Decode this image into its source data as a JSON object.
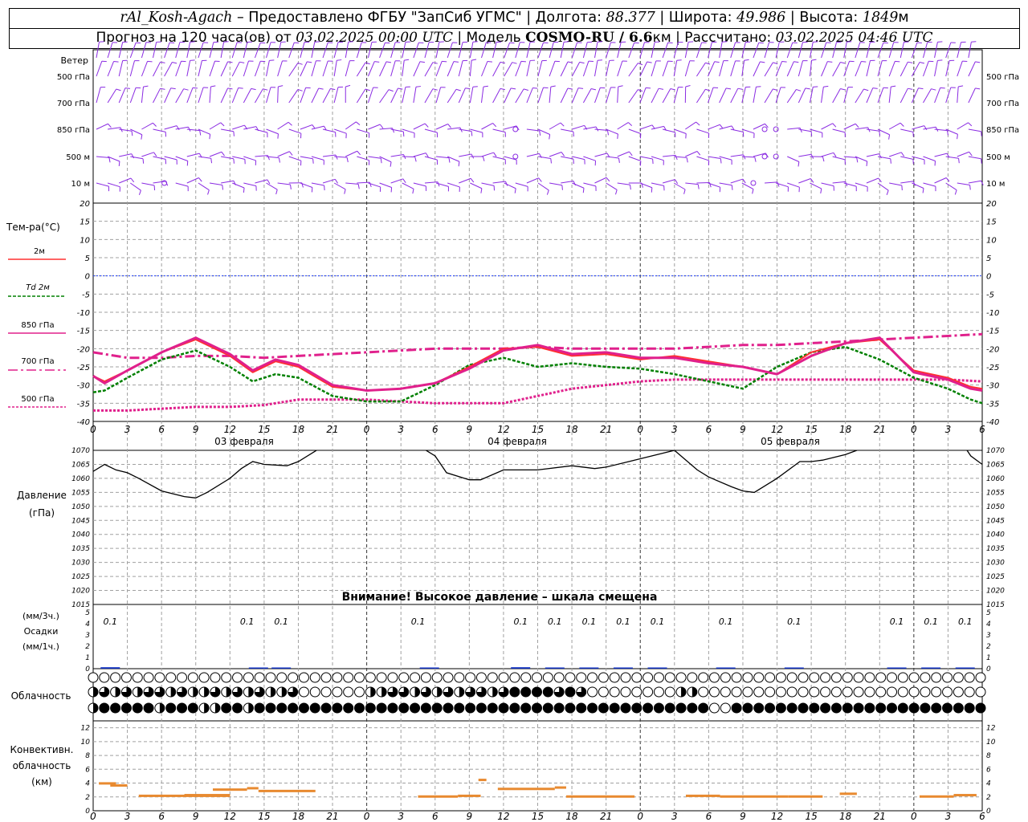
{
  "header": {
    "station": "rAl_Kosh-Agach",
    "provider": " – Предоставлено ФГБУ \"ЗапСиб УГМС\" | Долгота: ",
    "lon": "88.377",
    "lat_label": " | Широта: ",
    "lat": "49.986",
    "alt_label": " | Высота: ",
    "alt": "1849",
    "alt_unit": "м",
    "forecast_label": "Прогноз на 120 часа(ов) от ",
    "forecast_start": "03.02.2025 00:00 UTC",
    "model_label": " | Модель ",
    "model": "COSMO-RU / 6.6",
    "model_unit": "км",
    "calc_label": " | Рассчитано: ",
    "calc_time": "03.02.2025 04:46 UTC"
  },
  "labels": {
    "wind": "Ветер",
    "wind_levels": [
      "500 гПа",
      "700 гПа",
      "850 гПа",
      "500 м",
      "10 м"
    ],
    "temp_title": "Тем-ра(°С)",
    "legend": [
      "2м",
      "Td 2м",
      "850 гПа",
      "700 гПа",
      "500 гПа"
    ],
    "pressure_title": "Давление",
    "pressure_unit": "(гПа)",
    "pressure_warning": "Внимание! Высокое давление – шкала смещена",
    "precip_3h": "(мм/3ч.)",
    "precip_title": "Осадки",
    "precip_1h": "(мм/1ч.)",
    "cloud_title": "Облачность",
    "conv_title": [
      "Конвективн.",
      "облачность",
      "(км)"
    ],
    "dates": [
      "03 февраля",
      "04 февраля",
      "05 февраля"
    ]
  },
  "colors": {
    "t2m": "#ff3030",
    "td2m": "#008000",
    "t850": "#e0208c",
    "t700": "#e0208c",
    "t500": "#e0208c",
    "zero_line": "#2040ff",
    "wind": "#8a2be2",
    "pressure": "#000000",
    "precip": "#1030c0",
    "conv": "#e88a30",
    "grid": "#a0a0a0"
  },
  "chart_data": {
    "x_tick_labels": [
      "0",
      "3",
      "6",
      "9",
      "12",
      "15",
      "18",
      "21",
      "0",
      "3",
      "6",
      "9",
      "12",
      "15",
      "18",
      "21",
      "0",
      "3",
      "6",
      "9",
      "12",
      "15",
      "18",
      "21",
      "0",
      "3",
      "6"
    ],
    "x_hours_range": [
      0,
      78
    ],
    "temperature": {
      "type": "line",
      "ylim": [
        -40,
        20
      ],
      "y_ticks": [
        20,
        15,
        10,
        5,
        0,
        -5,
        -10,
        -15,
        -20,
        -25,
        -30,
        -35,
        -40
      ],
      "grid": true,
      "series": [
        {
          "name": "2м",
          "x": [
            0,
            1,
            3,
            6,
            9,
            12,
            14,
            16,
            18,
            21,
            24,
            27,
            30,
            33,
            36,
            39,
            42,
            45,
            48,
            51,
            54,
            57,
            60,
            63,
            66,
            69,
            72,
            75,
            77,
            78
          ],
          "values": [
            -27.5,
            -29,
            -26,
            -21,
            -17.5,
            -22,
            -26.5,
            -23.5,
            -25,
            -30.5,
            -31.5,
            -31,
            -29.5,
            -25,
            -20,
            -19.5,
            -22,
            -21.5,
            -23,
            -22,
            -23.5,
            -25,
            -27,
            -21,
            -18.5,
            -17.5,
            -26,
            -28,
            -30.5,
            -31
          ]
        },
        {
          "name": "Td 2м",
          "x": [
            0,
            1,
            3,
            6,
            9,
            12,
            14,
            16,
            18,
            21,
            24,
            27,
            30,
            33,
            36,
            39,
            42,
            45,
            48,
            51,
            54,
            57,
            60,
            63,
            66,
            69,
            72,
            75,
            77,
            78
          ],
          "values": [
            -32,
            -31.5,
            -28,
            -23,
            -20.5,
            -25,
            -29,
            -27,
            -28,
            -33,
            -34.5,
            -34.5,
            -30,
            -24.5,
            -22.5,
            -25,
            -24,
            -25,
            -25.5,
            -27,
            -29,
            -31,
            -25,
            -21,
            -19.5,
            -23,
            -28,
            -31,
            -34,
            -35
          ]
        },
        {
          "name": "850 гПа",
          "x": [
            0,
            1,
            3,
            6,
            9,
            12,
            14,
            16,
            18,
            21,
            24,
            27,
            30,
            33,
            36,
            39,
            42,
            45,
            48,
            51,
            54,
            57,
            60,
            63,
            66,
            69,
            72,
            75,
            77,
            78
          ],
          "values": [
            -27.5,
            -29.5,
            -26,
            -21,
            -17,
            -21.5,
            -26,
            -23,
            -24.5,
            -30,
            -31.5,
            -31,
            -29.5,
            -25.5,
            -20.5,
            -19,
            -21.5,
            -21,
            -22.5,
            -22.5,
            -24,
            -25,
            -27,
            -22,
            -18.5,
            -17,
            -26.5,
            -28.5,
            -31,
            -31.5
          ]
        },
        {
          "name": "700 гПа",
          "x": [
            0,
            3,
            6,
            9,
            12,
            15,
            18,
            21,
            24,
            27,
            30,
            33,
            36,
            39,
            42,
            45,
            48,
            51,
            54,
            57,
            60,
            63,
            66,
            69,
            72,
            75,
            78
          ],
          "values": [
            -21,
            -22.5,
            -22.5,
            -22,
            -22,
            -22.5,
            -22,
            -21.5,
            -21,
            -20.5,
            -20,
            -20,
            -20,
            -19.5,
            -20,
            -20,
            -20,
            -20,
            -19.5,
            -19,
            -19,
            -18.5,
            -18,
            -17.5,
            -17,
            -16.5,
            -16
          ]
        },
        {
          "name": "500 гПа",
          "x": [
            0,
            3,
            6,
            9,
            12,
            15,
            18,
            21,
            24,
            27,
            30,
            33,
            36,
            39,
            42,
            45,
            48,
            51,
            54,
            57,
            60,
            63,
            66,
            69,
            72,
            75,
            78
          ],
          "values": [
            -37,
            -37,
            -36.5,
            -36,
            -36,
            -35.5,
            -34,
            -34,
            -34,
            -34.5,
            -35,
            -35,
            -35,
            -33,
            -31,
            -30,
            -29,
            -28.5,
            -28.5,
            -28.5,
            -28.5,
            -28.5,
            -28.5,
            -28.5,
            -28.5,
            -28.5,
            -29
          ]
        }
      ]
    },
    "pressure": {
      "type": "line",
      "ylim": [
        1015,
        1070
      ],
      "y_ticks": [
        1070,
        1065,
        1060,
        1055,
        1050,
        1045,
        1040,
        1035,
        1030,
        1025,
        1020,
        1015
      ],
      "x": [
        0,
        1,
        2,
        3,
        4,
        6,
        8,
        9,
        10,
        12,
        13,
        14,
        15,
        17,
        18,
        20,
        22,
        24,
        25,
        27,
        28,
        30,
        31,
        33,
        34,
        36,
        39,
        42,
        44,
        45,
        47,
        49,
        51,
        53,
        54,
        56,
        57,
        58,
        60,
        62,
        63,
        64,
        66,
        67,
        68,
        69,
        71,
        72,
        74,
        76,
        77,
        78
      ],
      "values": [
        1062.5,
        1065,
        1063,
        1062,
        1060,
        1055.5,
        1053.5,
        1053,
        1055,
        1060,
        1063.5,
        1066,
        1065,
        1064.5,
        1066,
        1071,
        1076,
        1078,
        1078,
        1077,
        1073,
        1068,
        1062,
        1059.5,
        1059.5,
        1063,
        1063,
        1064.5,
        1063.5,
        1064,
        1066,
        1068,
        1070,
        1063,
        1060.5,
        1057,
        1055.5,
        1055,
        1060,
        1066,
        1066,
        1066.5,
        1068.5,
        1070,
        1072,
        1077,
        1078.5,
        1078,
        1077,
        1074,
        1068,
        1065
      ]
    },
    "precip_3h": {
      "type": "bar",
      "ylim": [
        0,
        5
      ],
      "y_ticks": [
        5,
        4,
        3,
        2,
        1,
        0
      ],
      "labels": [
        "0.1",
        "0.1",
        "0.1",
        "0.1",
        "0.1",
        "0.1",
        "0.1",
        "0.1",
        "0.1",
        "0.1",
        "0.1",
        "0.1",
        "0.1",
        "0.1"
      ],
      "label_x": [
        1.5,
        13.5,
        16.5,
        28.5,
        37.5,
        40.5,
        43.5,
        46.5,
        49.5,
        55.5,
        61.5,
        70.5,
        73.5,
        76.5
      ],
      "bar_x": [
        1.5,
        14.5,
        16.5,
        29.5,
        37.5,
        40.5,
        43.5,
        46.5,
        49.5,
        55.5,
        61.5,
        70.5,
        73.5,
        76.5
      ],
      "bar_values": [
        0.1,
        0.05,
        0.05,
        0.05,
        0.1,
        0.05,
        0.05,
        0.05,
        0.05,
        0.05,
        0.05,
        0.05,
        0.05,
        0.05
      ]
    },
    "cloud_rows": {
      "row1": "ooooooooooooooooooooooooooooooooooooooooooooooooooooooooooooooooooooooooooooooooo",
      "row2": "hqhqhqqhqhhqhqhqhhqoooooohhqqhqhqhqqhqffffqfqoooooooohhoooooooooooooooooooooooooo",
      "row3": "hfffffhfffhhffhfffffffffffffffffffffffffffffffffffffffffoofffffffffffffffffffffff"
    },
    "convective": {
      "type": "bar",
      "ylim": [
        0,
        13
      ],
      "y_ticks": [
        12,
        10,
        8,
        6,
        4,
        2,
        0
      ],
      "segments": [
        [
          0.5,
          2,
          3.9
        ],
        [
          1.5,
          3,
          3.6
        ],
        [
          4,
          12,
          2.1
        ],
        [
          8,
          12,
          2.2
        ],
        [
          10.5,
          13.5,
          3.0
        ],
        [
          13.5,
          14.5,
          3.2
        ],
        [
          14.5,
          19.5,
          2.8
        ],
        [
          28.5,
          32,
          2.0
        ],
        [
          32,
          34,
          2.1
        ],
        [
          33.8,
          34.5,
          4.4
        ],
        [
          35.5,
          40.5,
          3.1
        ],
        [
          40.5,
          41.5,
          3.3
        ],
        [
          41.5,
          47.5,
          2.0
        ],
        [
          52,
          55,
          2.1
        ],
        [
          55,
          61,
          2.0
        ],
        [
          61,
          64,
          2.0
        ],
        [
          65.5,
          67,
          2.4
        ],
        [
          72.5,
          75.5,
          2.0
        ],
        [
          75.5,
          77.5,
          2.2
        ]
      ]
    },
    "wind_barbs": {
      "levels": [
        "500 гПа",
        "700 гПа",
        "850 гПа",
        "500 м",
        "10 м"
      ],
      "calm_marks": [
        [
          37,
          2
        ],
        [
          37,
          3
        ],
        [
          27.5,
          4
        ],
        [
          59,
          2
        ],
        [
          59,
          3
        ],
        [
          60,
          2
        ],
        [
          60,
          3
        ],
        [
          58,
          4
        ],
        [
          6,
          4
        ]
      ]
    }
  }
}
